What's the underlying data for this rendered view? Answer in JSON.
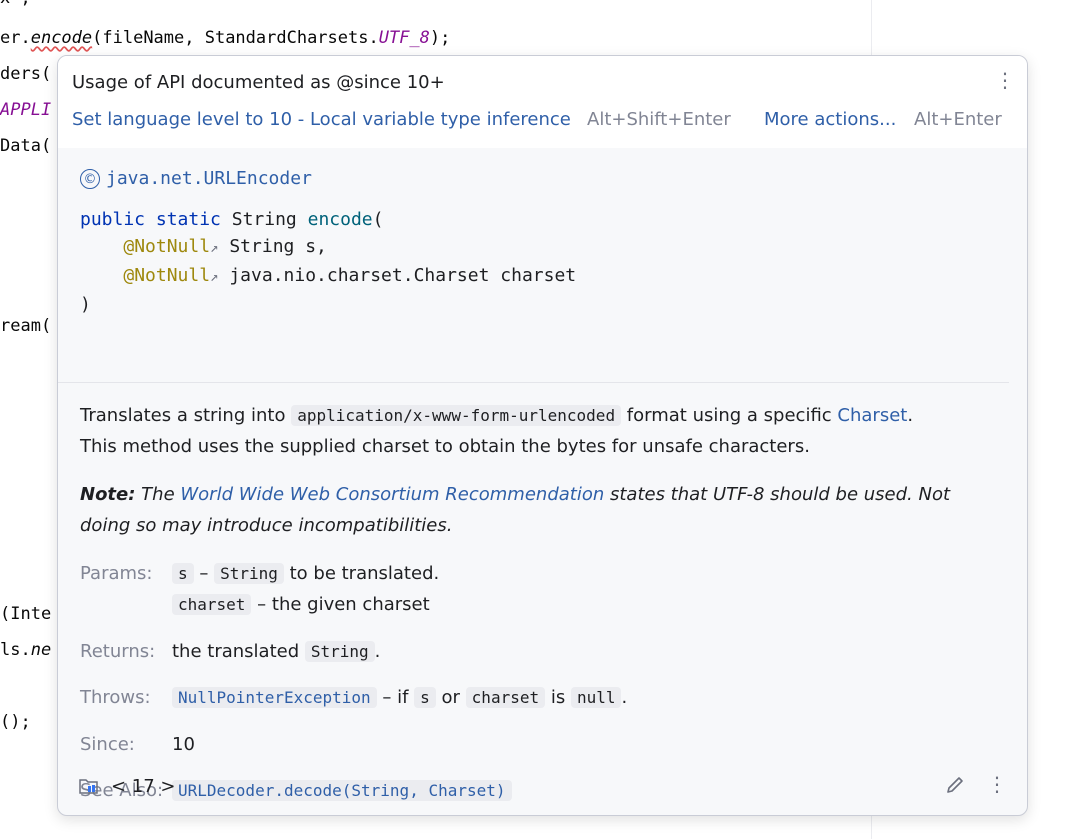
{
  "editor": {
    "lines": [
      {
        "segments": [
          {
            "t": "x\";",
            "cls": ""
          }
        ]
      },
      {
        "segments": [
          {
            "t": "er.",
            "cls": ""
          },
          {
            "t": "encode",
            "cls": "italic-method squiggle"
          },
          {
            "t": "(fileName, StandardCharsets.",
            "cls": ""
          },
          {
            "t": "UTF_8",
            "cls": "purple"
          },
          {
            "t": ");",
            "cls": ""
          }
        ]
      },
      {
        "segments": [
          {
            "t": "ders(",
            "cls": ""
          }
        ]
      },
      {
        "segments": [
          {
            "t": "APPLI",
            "cls": "purple"
          }
        ]
      },
      {
        "segments": [
          {
            "t": "Data(",
            "cls": ""
          }
        ]
      },
      {
        "segments": [
          {
            "t": "ream(",
            "cls": ""
          }
        ]
      },
      {
        "segments": [
          {
            "t": "(Inte",
            "cls": ""
          }
        ]
      },
      {
        "segments": [
          {
            "t": "ls.",
            "cls": ""
          },
          {
            "t": "ne",
            "cls": "italic-method"
          }
        ]
      },
      {
        "segments": [
          {
            "t": "();",
            "cls": ""
          }
        ]
      }
    ]
  },
  "popup": {
    "title": "Usage of API documented as @since 10+",
    "fix_label": "Set language level to 10 - Local variable type inference",
    "fix_shortcut": "Alt+Shift+Enter",
    "more_label": "More actions...",
    "more_shortcut": "Alt+Enter",
    "menu_icon": "⋮",
    "class_icon": "©",
    "class_name": "java.net.URLEncoder",
    "signature": {
      "kw1": "public static",
      "ret": "String",
      "method": "encode",
      "open": "(",
      "ann": "@NotNull",
      "ext": "↗",
      "param1": "String s,",
      "param2": "java.nio.charset.Charset charset",
      "close": ")"
    },
    "desc": {
      "p1_a": "Translates a string into ",
      "p1_code": "application/x-www-form-urlencoded",
      "p1_b": " format using a specific ",
      "p1_link": "Charset",
      "p1_c": ".",
      "p1_d": "This method uses the supplied charset to obtain the bytes for unsafe characters."
    },
    "note": {
      "label": "Note:",
      "a": " The ",
      "link": "World Wide Web Consortium Recommendation",
      "b": " states that UTF-8 should be used. Not doing so may introduce incompatibilities."
    },
    "params": {
      "label": "Params:",
      "p1_name": "s",
      "p1_dash": " – ",
      "p1_type": "String",
      "p1_desc": " to be translated.",
      "p2_name": "charset",
      "p2_desc": " – the given charset"
    },
    "returns": {
      "label": "Returns:",
      "a": "the translated ",
      "code": "String",
      "b": "."
    },
    "throws": {
      "label": "Throws:",
      "exc": "NullPointerException",
      "a": " – if ",
      "c1": "s",
      "b": " or ",
      "c2": "charset",
      "c": " is ",
      "c3": "null",
      "d": "."
    },
    "since": {
      "label": "Since:",
      "value": "10"
    },
    "see_also": {
      "label": "See Also:",
      "value": "URLDecoder.decode(String, Charset)"
    },
    "footer": {
      "nav": "< 17 >"
    }
  }
}
